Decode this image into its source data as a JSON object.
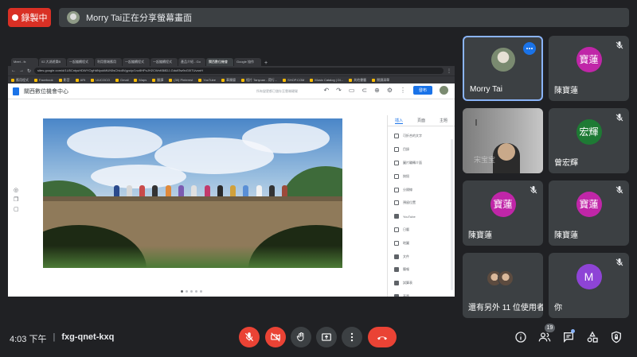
{
  "recording": {
    "label": "錄製中"
  },
  "presenter_banner": {
    "text": "Morry Tai正在分享螢幕畫面"
  },
  "browser": {
    "tabs": [
      "Meet - fx",
      "02.大湖遊樂B",
      "一起繼續程式",
      "利用雲端應用",
      "一起繼續程式",
      "一起繼續程式",
      "產品介紹 - Go",
      "關西數位機會",
      "Google 協作"
    ],
    "active_tab": 7,
    "url": "sites.google.com/d/1U5CntyuHDWYOgHdNyukMUN5sChio8Vgyu/p/1nz8HPuJH2CWnKB8DJ-Gdulf3w9oG0ITUvanH",
    "bookmarks": [
      "應用程式",
      "Facebook",
      "影音",
      "ARt",
      "UUCOCO",
      "Gmail",
      "Maps",
      "翻譯",
      "(30) Pinterest",
      "YouTube",
      "華陳錦",
      "相片 Tanyuan - 荷行...",
      "SHOP.COM",
      "Music Catalog | Di...",
      "其他書籤",
      "閱讀清單"
    ]
  },
  "sites": {
    "title": "關西數位機會中心",
    "draft_note": "所有變更都已儲存至雲端硬碟",
    "publish_label": "發布",
    "panel_tabs": [
      "插入",
      "頁面",
      "主題"
    ],
    "insert_items": [
      "可折合的文字",
      "目錄",
      "圖片輪轉介面",
      "按鈕",
      "分隔線",
      "預留位置",
      "YouTube",
      "日曆",
      "地圖",
      "文件",
      "簡報",
      "試算表",
      "表單"
    ]
  },
  "participants": [
    {
      "name": "Morry Tai",
      "avatar": "photo",
      "muted": false,
      "active": true
    },
    {
      "name": "陳寶蓮",
      "avatar_text": "寶蓮",
      "color": "#c026a8",
      "muted": true
    },
    {
      "name": "",
      "avatar": "camera",
      "cam_label": "宋宝宝",
      "muted": false
    },
    {
      "name": "曾宏輝",
      "avatar_text": "宏輝",
      "color": "#1e7a34",
      "muted": true
    },
    {
      "name": "陳寶蓮",
      "avatar_text": "寶蓮",
      "color": "#c026a8",
      "muted": true
    },
    {
      "name": "陳寶蓮",
      "avatar_text": "寶蓮",
      "color": "#c026a8",
      "muted": true
    },
    {
      "name": "還有另外 11 位使用者",
      "avatar": "group",
      "muted": false
    },
    {
      "name": "你",
      "avatar_text": "M",
      "color": "#8e44d6",
      "muted": true
    }
  ],
  "meeting": {
    "time": "4:03 下午",
    "separator": "|",
    "code": "fxg-qnet-kxq"
  },
  "toolbar": {
    "controls": [
      "mic-off",
      "camera-off",
      "raise-hand",
      "present",
      "more",
      "hang-up"
    ],
    "people_count": "19",
    "utilities": [
      "info",
      "people",
      "chat",
      "activities",
      "host-controls"
    ]
  },
  "colors": {
    "background": "#202124",
    "tile": "#3c4043",
    "danger": "#ea4335",
    "accent": "#8ab4f8"
  }
}
